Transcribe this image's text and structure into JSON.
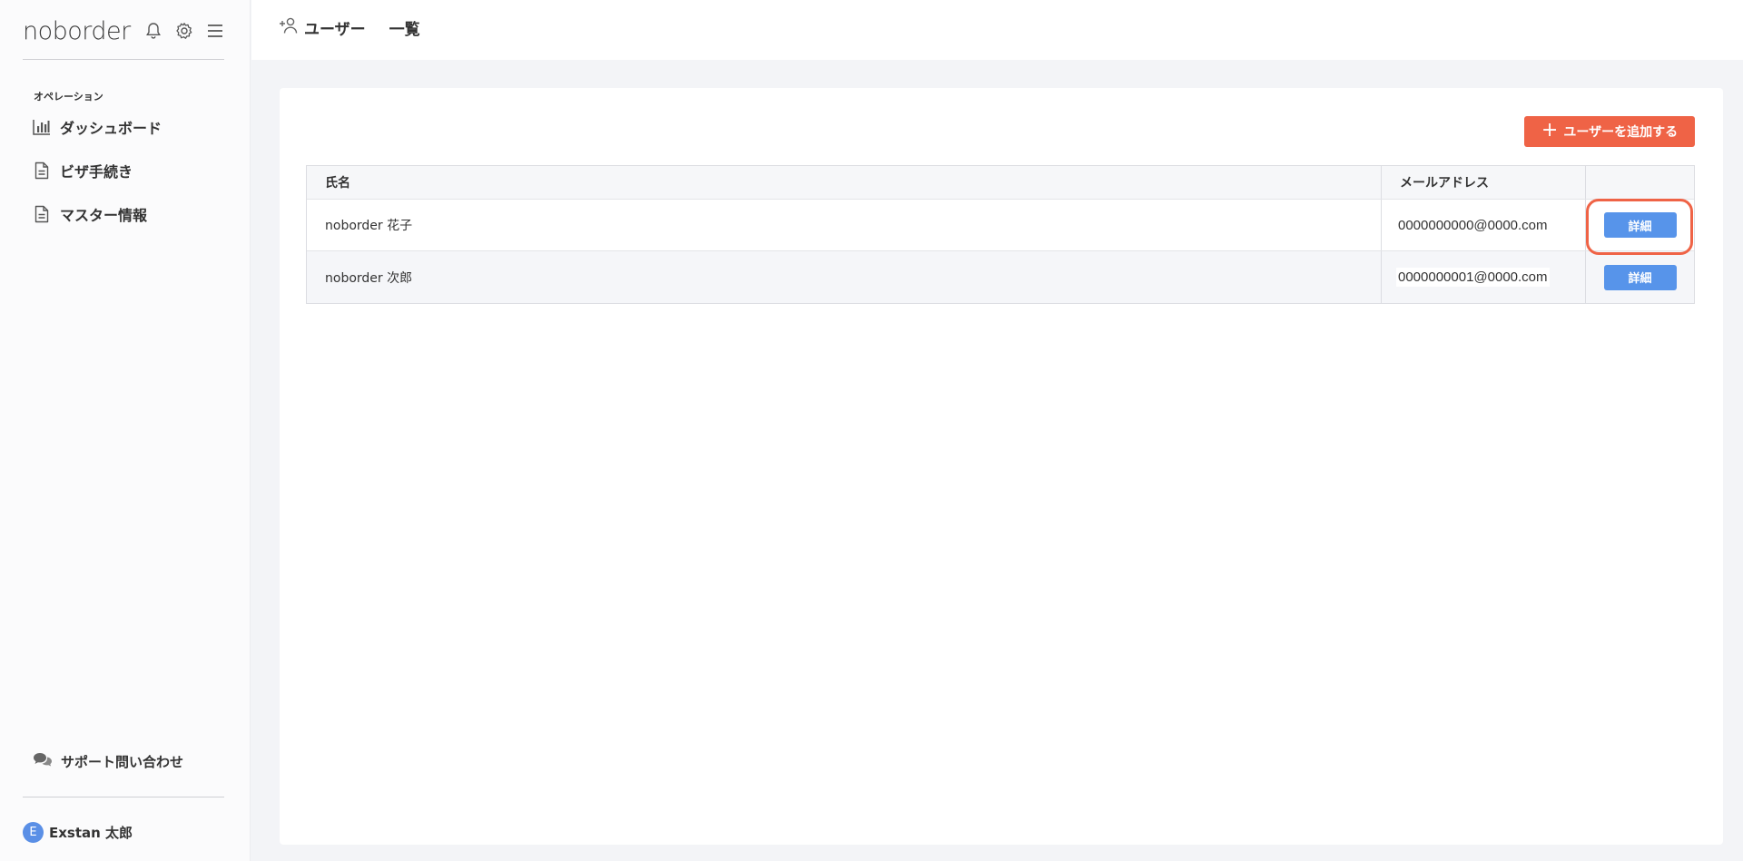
{
  "sidebar": {
    "logo": "noborder",
    "section_label": "オペレーション",
    "items": [
      {
        "label": "ダッシュボード",
        "icon": "bar-chart-icon"
      },
      {
        "label": "ビザ手続き",
        "icon": "document-icon"
      },
      {
        "label": "マスター情報",
        "icon": "document-icon"
      }
    ],
    "support_label": "サポート問い合わせ",
    "user": {
      "initial": "E",
      "name": "Exstan 太郎"
    }
  },
  "header": {
    "title_part1": "ユーザー",
    "title_part2": "一覧"
  },
  "main": {
    "add_button_label": "ユーザーを追加する",
    "table": {
      "columns": [
        "氏名",
        "メールアドレス",
        ""
      ],
      "rows": [
        {
          "name": "noborder 花子",
          "email": "0000000000@0000.com",
          "action": "詳細"
        },
        {
          "name": "noborder 次郎",
          "email": "0000000001@0000.com",
          "action": "詳細"
        }
      ]
    }
  },
  "colors": {
    "accent": "#ef6346",
    "primary_button": "#5794ea"
  }
}
